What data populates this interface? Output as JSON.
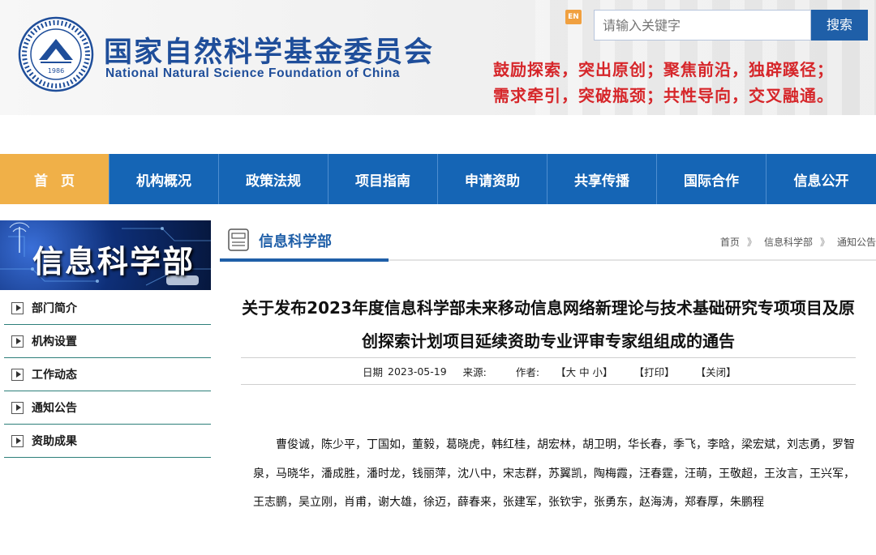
{
  "header": {
    "org_cn": "国家自然科学基金委员会",
    "org_en": "National Natural Science Foundation of China",
    "seal_year": "1986",
    "lang_toggle": "EN",
    "search_placeholder": "请输入关键字",
    "search_button": "搜索",
    "slogan_line1": "鼓励探索，突出原创；聚焦前沿，独辟蹊径；",
    "slogan_line2": "需求牵引，突破瓶颈；共性导向，交叉融通。"
  },
  "nav": {
    "items": [
      {
        "label": "首页",
        "active": true
      },
      {
        "label": "机构概况"
      },
      {
        "label": "政策法规"
      },
      {
        "label": "项目指南"
      },
      {
        "label": "申请资助"
      },
      {
        "label": "共享传播"
      },
      {
        "label": "国际合作"
      },
      {
        "label": "信息公开"
      }
    ]
  },
  "sidebar": {
    "banner_title": "信息科学部",
    "items": [
      {
        "label": "部门简介"
      },
      {
        "label": "机构设置"
      },
      {
        "label": "工作动态"
      },
      {
        "label": "通知公告"
      },
      {
        "label": "资助成果"
      }
    ]
  },
  "column": {
    "title": "信息科学部",
    "breadcrumb": [
      "首页",
      "信息科学部",
      "通知公告"
    ],
    "breadcrumb_sep": "》"
  },
  "article": {
    "title": "关于发布2023年度信息科学部未来移动信息网络新理论与技术基础研究专项项目及原创探索计划项目延续资助专业评审专家组组成的通告",
    "date_label": "日期",
    "date": "2023-05-19",
    "source_label": "来源:",
    "author_label": "作者:",
    "font_size_control": "【大 中 小】",
    "print_link": "【打印】",
    "close_link": "【关闭】",
    "body": "曹俊诚，陈少平，丁国如，董毅，葛晓虎，韩红桂，胡宏林，胡卫明，华长春，季飞，李晗，梁宏斌，刘志勇，罗智泉，马晓华，潘成胜，潘时龙，钱丽萍，沈八中，宋志群，苏翼凯，陶梅霞，汪春霆，汪萌，王敬超，王汝言，王兴军，王志鹏，吴立刚，肖甫，谢大雄，徐迈，薛春来，张建军，张钦宇，张勇东，赵海涛，郑春厚，朱鹏程"
  }
}
